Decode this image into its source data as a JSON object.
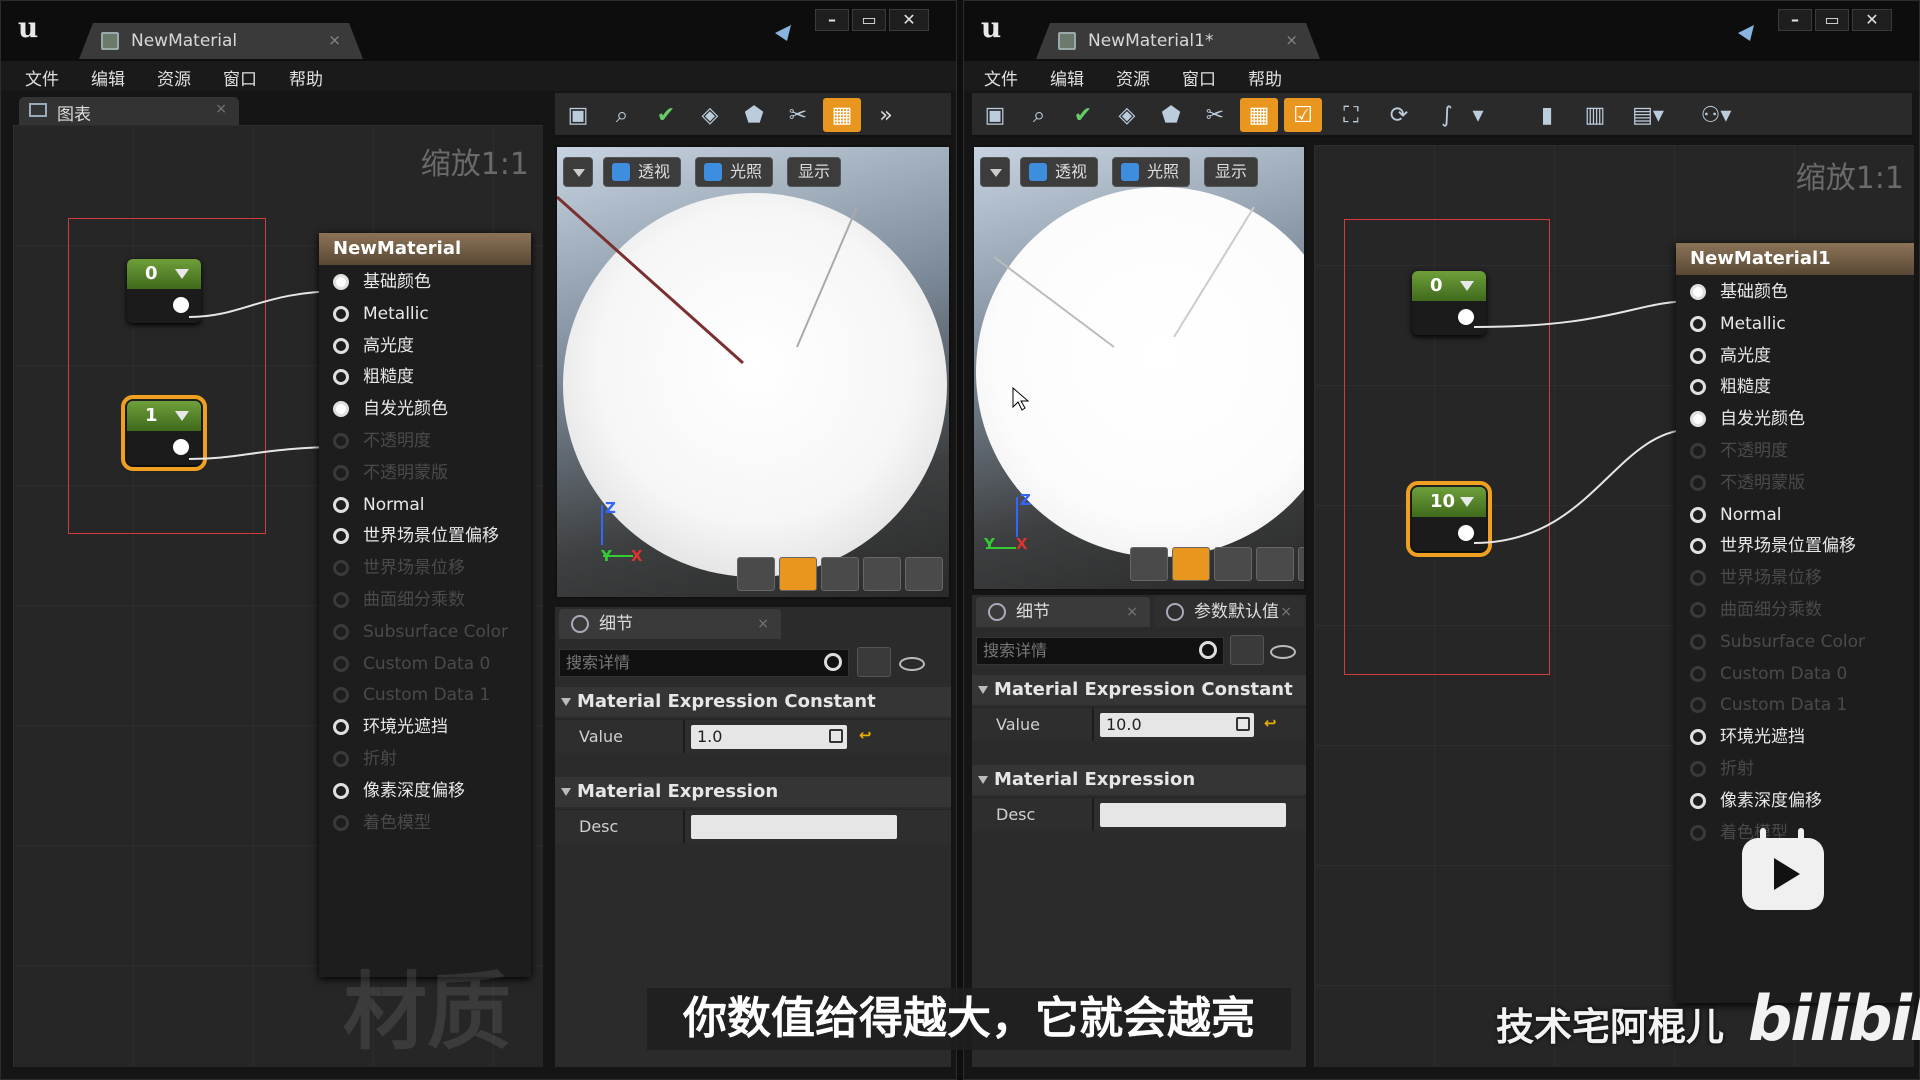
{
  "left": {
    "tab_title": "NewMaterial",
    "menu": [
      "文件",
      "编辑",
      "资源",
      "窗口",
      "帮助"
    ],
    "graph_tab": "图表",
    "zoom": "缩放1:1",
    "watermark": "材质",
    "constants": [
      "0",
      "1"
    ],
    "material_node": {
      "title": "NewMaterial",
      "pins": [
        {
          "label": "基础颜色",
          "state": "connected"
        },
        {
          "label": "Metallic",
          "state": "active"
        },
        {
          "label": "高光度",
          "state": "active"
        },
        {
          "label": "粗糙度",
          "state": "active"
        },
        {
          "label": "自发光颜色",
          "state": "connected"
        },
        {
          "label": "不透明度",
          "state": "disabled"
        },
        {
          "label": "不透明蒙版",
          "state": "disabled"
        },
        {
          "label": "Normal",
          "state": "active"
        },
        {
          "label": "世界场景位置偏移",
          "state": "active"
        },
        {
          "label": "世界场景位移",
          "state": "disabled"
        },
        {
          "label": "曲面细分乘数",
          "state": "disabled"
        },
        {
          "label": "Subsurface Color",
          "state": "disabled"
        },
        {
          "label": "Custom Data 0",
          "state": "disabled"
        },
        {
          "label": "Custom Data 1",
          "state": "disabled"
        },
        {
          "label": "环境光遮挡",
          "state": "active"
        },
        {
          "label": "折射",
          "state": "disabled"
        },
        {
          "label": "像素深度偏移",
          "state": "active"
        },
        {
          "label": "着色模型",
          "state": "disabled"
        }
      ]
    },
    "viewport": {
      "buttons": [
        "透视",
        "光照",
        "显示"
      ],
      "axis_y": "Y",
      "axis_x": "X",
      "axis_z": "Z"
    },
    "details": {
      "tab": "细节",
      "search_placeholder": "搜索详情",
      "section1": "Material Expression Constant",
      "value_label": "Value",
      "value": "1.0",
      "section2": "Material Expression",
      "desc_label": "Desc"
    }
  },
  "right": {
    "tab_title": "NewMaterial1*",
    "menu": [
      "文件",
      "编辑",
      "资源",
      "窗口",
      "帮助"
    ],
    "zoom": "缩放1:1",
    "constants": [
      "0",
      "10"
    ],
    "material_node": {
      "title": "NewMaterial1",
      "pins": [
        {
          "label": "基础颜色",
          "state": "connected"
        },
        {
          "label": "Metallic",
          "state": "active"
        },
        {
          "label": "高光度",
          "state": "active"
        },
        {
          "label": "粗糙度",
          "state": "active"
        },
        {
          "label": "自发光颜色",
          "state": "connected"
        },
        {
          "label": "不透明度",
          "state": "disabled"
        },
        {
          "label": "不透明蒙版",
          "state": "disabled"
        },
        {
          "label": "Normal",
          "state": "active"
        },
        {
          "label": "世界场景位置偏移",
          "state": "active"
        },
        {
          "label": "世界场景位移",
          "state": "disabled"
        },
        {
          "label": "曲面细分乘数",
          "state": "disabled"
        },
        {
          "label": "Subsurface Color",
          "state": "disabled"
        },
        {
          "label": "Custom Data 0",
          "state": "disabled"
        },
        {
          "label": "Custom Data 1",
          "state": "disabled"
        },
        {
          "label": "环境光遮挡",
          "state": "active"
        },
        {
          "label": "折射",
          "state": "disabled"
        },
        {
          "label": "像素深度偏移",
          "state": "active"
        },
        {
          "label": "着色模型",
          "state": "disabled"
        }
      ]
    },
    "viewport": {
      "buttons": [
        "透视",
        "光照",
        "显示"
      ],
      "axis_y": "Y",
      "axis_x": "X",
      "axis_z": "Z"
    },
    "details": {
      "tab": "细节",
      "tab2": "参数默认值",
      "search_placeholder": "搜索详情",
      "section1": "Material Expression Constant",
      "value_label": "Value",
      "value": "10.0",
      "section2": "Material Expression",
      "desc_label": "Desc"
    }
  },
  "overlay": {
    "subtitle": "你数值给得越大，它就会越亮",
    "channel": "技术宅阿棍儿",
    "brand": "bilibili"
  },
  "colors": {
    "accent": "#e8961e",
    "constant_header": "#5a8a2b",
    "material_header": "#7a6248",
    "selection": "#d23c3c"
  },
  "icons": [
    "ue-logo-icon",
    "save-icon",
    "find-icon",
    "apply-icon",
    "play-icon",
    "close-icon",
    "minimize-icon",
    "maximize-icon"
  ]
}
